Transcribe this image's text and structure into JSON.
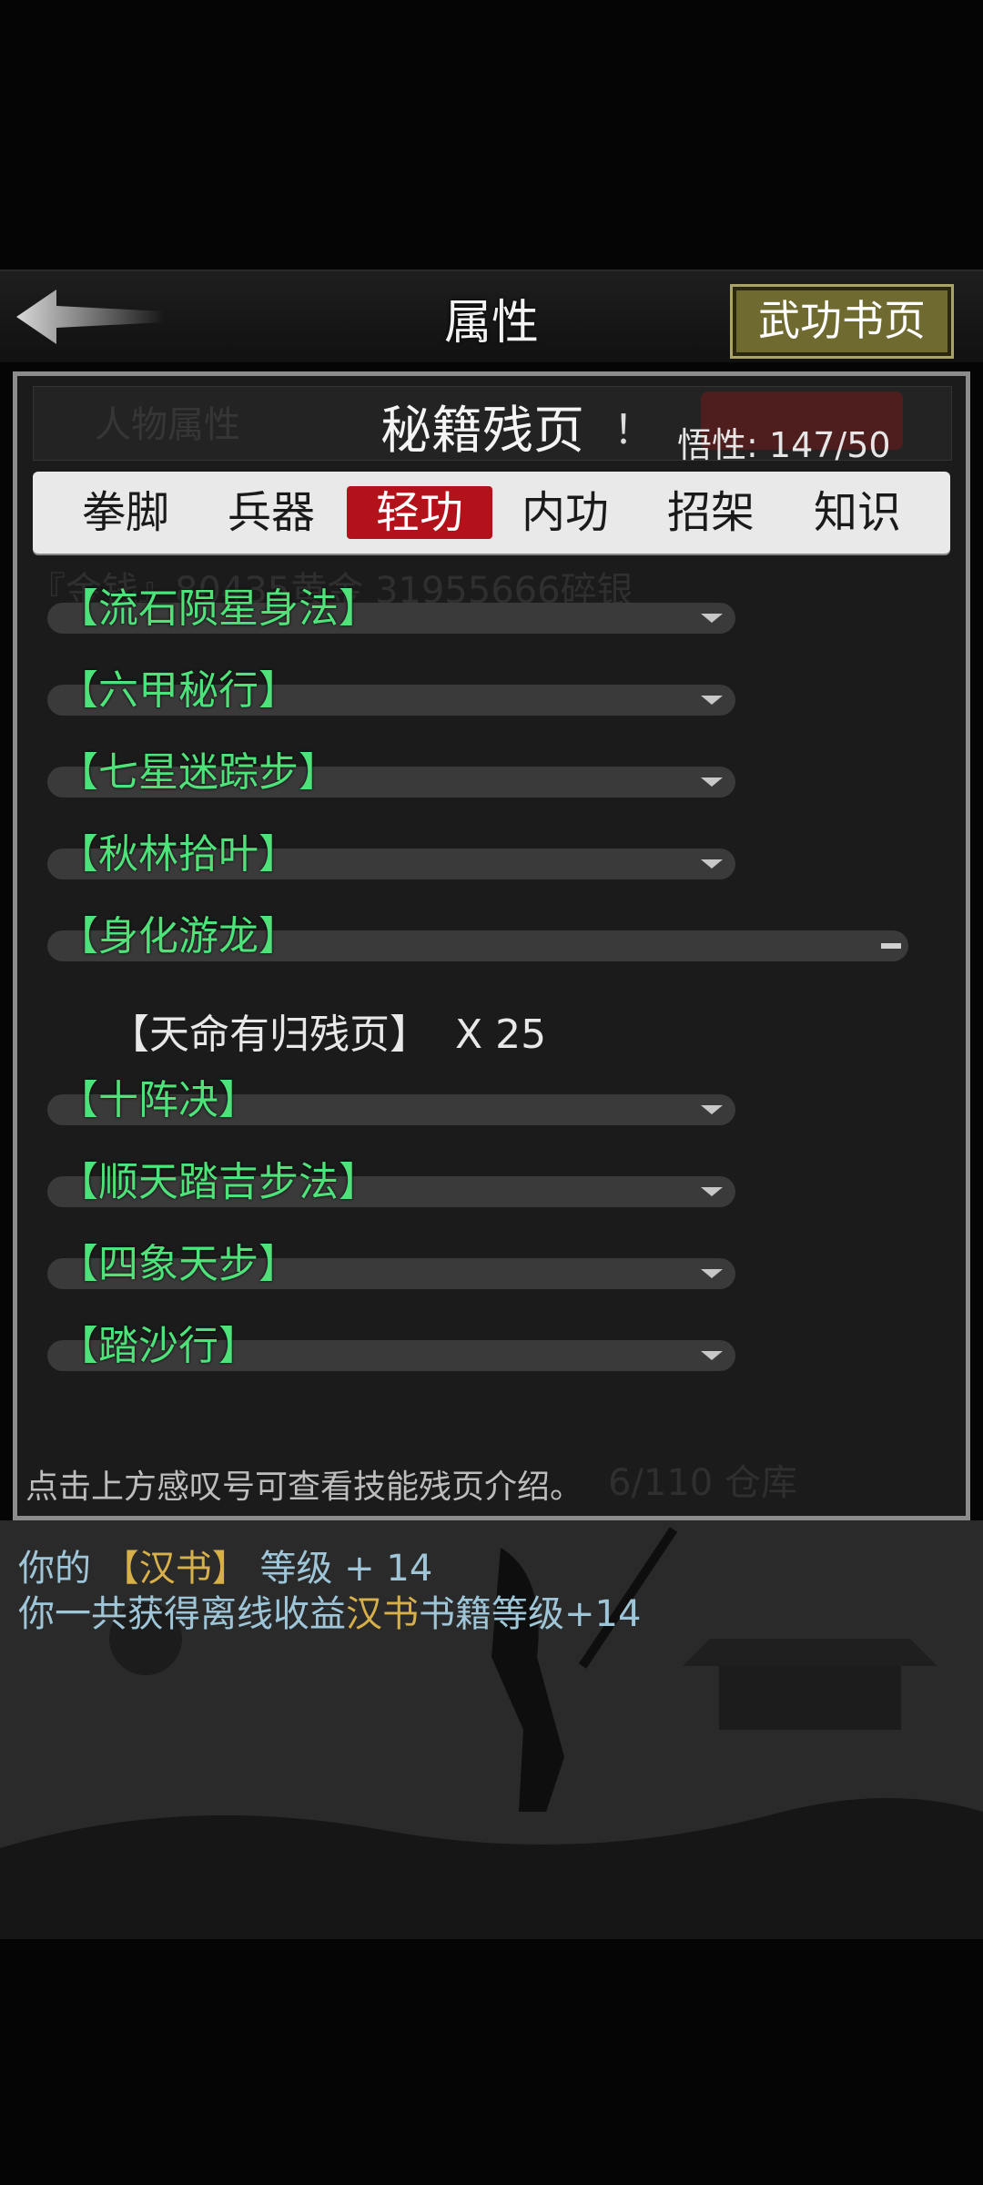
{
  "header": {
    "title": "属性",
    "book_button": "武功书页"
  },
  "background": {
    "character_tab": "人物属性",
    "money": "『金钱』80435黄金 31955666碎银",
    "warehouse": "6/110 仓库"
  },
  "panel": {
    "title": "秘籍残页",
    "exclaim": "！",
    "wuxing_label": "悟性:",
    "wuxing_value": "147/50"
  },
  "tabs": [
    {
      "label": "拳脚",
      "active": false
    },
    {
      "label": "兵器",
      "active": false
    },
    {
      "label": "轻功",
      "active": true
    },
    {
      "label": "内功",
      "active": false
    },
    {
      "label": "招架",
      "active": false
    },
    {
      "label": "知识",
      "active": false
    }
  ],
  "skills": [
    {
      "name": "【流石陨星身法】",
      "expanded": false
    },
    {
      "name": "【六甲秘行】",
      "expanded": false
    },
    {
      "name": "【七星迷踪步】",
      "expanded": false
    },
    {
      "name": "【秋林拾叶】",
      "expanded": false
    },
    {
      "name": "【身化游龙】",
      "expanded": true
    },
    {
      "name": "【十阵决】",
      "expanded": false
    },
    {
      "name": "【顺天踏吉步法】",
      "expanded": false
    },
    {
      "name": "【四象天步】",
      "expanded": false
    },
    {
      "name": "【踏沙行】",
      "expanded": false
    }
  ],
  "expanded_item": {
    "name": "【天命有归残页】",
    "count": "X 25"
  },
  "hint": "点击上方感叹号可查看技能残页介绍。",
  "log": {
    "line1_prefix": "你的",
    "line1_book": "【汉书】",
    "line1_suffix": "等级 + 14",
    "line2_prefix": "你一共获得离线收益",
    "line2_book": "汉书",
    "line2_suffix": "书籍等级+14"
  },
  "colors": {
    "accent_red": "#b4121a",
    "skill_green": "#4ee27a",
    "gold": "#d8b04a",
    "log_blue": "#9ec6d8"
  }
}
